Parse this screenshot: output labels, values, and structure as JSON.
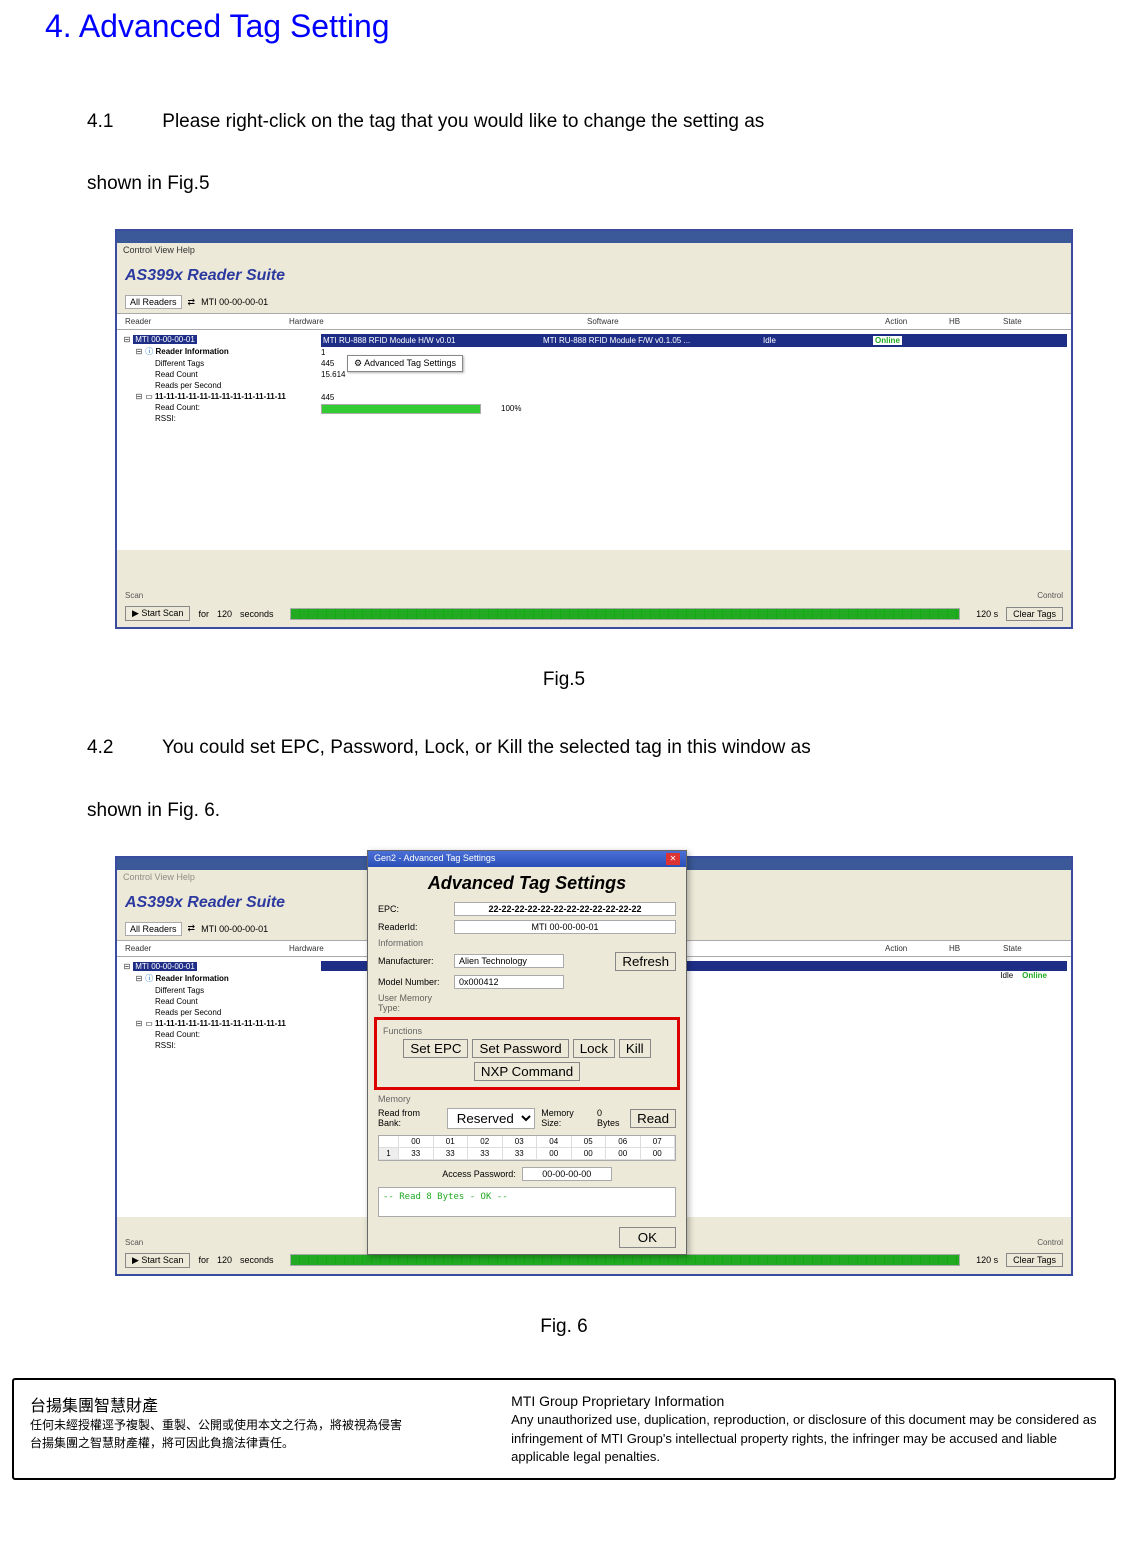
{
  "heading": "4. Advanced Tag Setting",
  "p41_num": "4.1",
  "p41_text": "Please right-click on the tag that you would like to change the setting as",
  "p41_cont": "shown in Fig.5",
  "fig5_caption": "Fig.5",
  "p42_num": "4.2",
  "p42_text": "You could set EPC, Password, Lock, or Kill the selected tag in this window as",
  "p42_cont": "shown in Fig. 6.",
  "fig6_caption": "Fig. 6",
  "win": {
    "menubar": "Control    View    Help",
    "suite_title": "AS399x Reader Suite",
    "all_readers": "All Readers",
    "reader_id": "MTI 00-00-00-01",
    "cols": {
      "reader": "Reader",
      "hardware": "Hardware",
      "software": "Software",
      "action": "Action",
      "hb": "HB",
      "state": "State"
    },
    "tree": {
      "root": "MTI 00-00-00-01",
      "info": "Reader Information",
      "diff_tags": "Different Tags",
      "read_count": "Read Count",
      "rps": "Reads per Second",
      "tag": "11-11-11-11-11-11-11-11-11-11-11-11",
      "rc_label": "Read Count:",
      "rssi": "RSSI:"
    },
    "details": {
      "hw": "MTI RU-888 RFID Module H/W v0.01",
      "sw": "MTI RU-888 RFID Module F/W v0.1.05 ...",
      "idle": "Idle",
      "online": "Online",
      "diff_tags_v": "1",
      "read_count_v": "445",
      "rps_v": "15.614",
      "tag_rc": "445",
      "pct": "100%"
    },
    "ctx_menu": "Advanced Tag Settings",
    "scan_label": "Scan",
    "start_scan": "Start Scan",
    "for_label": "for",
    "for_val": "120",
    "sec_label": "seconds",
    "elapsed": "120 s",
    "control_label": "Control",
    "clear_tags": "Clear Tags"
  },
  "dlg": {
    "title": "Gen2 - Advanced Tag Settings",
    "head": "Advanced Tag Settings",
    "epc_label": "EPC:",
    "epc_val": "22-22-22-22-22-22-22-22-22-22-22-22",
    "reader_label": "ReaderId:",
    "reader_val": "MTI 00-00-00-01",
    "info_label": "Information",
    "mfr_label": "Manufacturer:",
    "mfr_val": "Alien Technology",
    "model_label": "Model Number:",
    "model_val": "0x000412",
    "umt_label": "User Memory Type:",
    "refresh": "Refresh",
    "func_label": "Functions",
    "btn_setepc": "Set EPC",
    "btn_setpwd": "Set Password",
    "btn_lock": "Lock",
    "btn_kill": "Kill",
    "btn_nxp": "NXP Command",
    "mem_label": "Memory",
    "read_from": "Read from Bank:",
    "bank_val": "Reserved",
    "memsize_label": "Memory Size:",
    "memsize_val": "0 Bytes",
    "read_btn": "Read",
    "mem_hdr": [
      "",
      "00",
      "01",
      "02",
      "03",
      "04",
      "05",
      "06",
      "07"
    ],
    "mem_row_idx": "1",
    "mem_row": [
      "33",
      "33",
      "33",
      "33",
      "00",
      "00",
      "00",
      "00"
    ],
    "access_pwd_label": "Access Password:",
    "access_pwd_val": "00-00-00-00",
    "status": "-- Read 8 Bytes - OK --",
    "ok": "OK"
  },
  "footer": {
    "left_title": "台揚集團智慧財產",
    "left_line1": "任何未經授權逕予複製、重製、公開或使用本文之行為，將被視為侵害",
    "left_line2": "台揚集團之智慧財產權，將可因此負擔法律責任。",
    "right_title": "MTI Group Proprietary Information",
    "right_body": "Any unauthorized use, duplication, reproduction, or disclosure of this document may be considered as infringement of MTI Group's intellectual property rights, the infringer may be accused and liable applicable legal penalties."
  }
}
